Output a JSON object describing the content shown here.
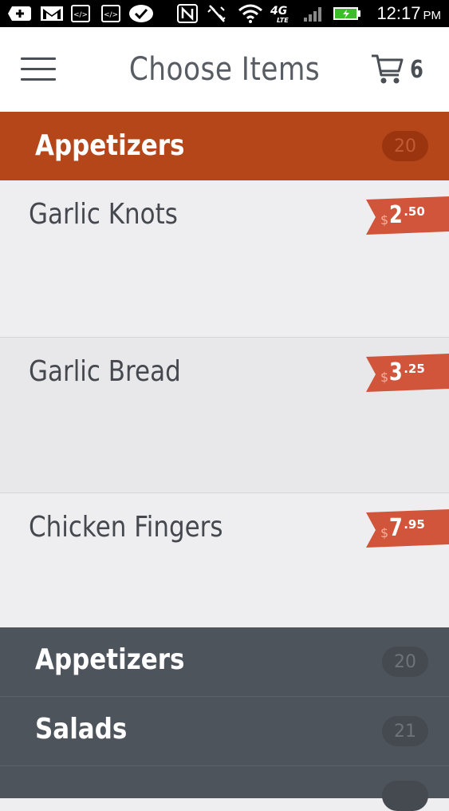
{
  "status_bar": {
    "time": "12:17",
    "ampm": "PM",
    "network": "4G LTE",
    "icons": [
      "add-icon",
      "gmail-icon",
      "code-icon",
      "code-icon",
      "check-bubble-icon",
      "nfc-icon",
      "vibrate-icon",
      "wifi-icon",
      "lte-icon",
      "signal-icon",
      "battery-icon"
    ]
  },
  "header": {
    "title": "Choose Items",
    "cart_count": "6"
  },
  "active_category": {
    "name": "Appetizers",
    "count": "20"
  },
  "items": [
    {
      "name": "Garlic Knots",
      "price_dollar": "$",
      "price_whole": "2",
      "price_cents": ".50"
    },
    {
      "name": "Garlic Bread",
      "price_dollar": "$",
      "price_whole": "3",
      "price_cents": ".25"
    },
    {
      "name": "Chicken Fingers",
      "price_dollar": "$",
      "price_whole": "7",
      "price_cents": ".95"
    }
  ],
  "categories": [
    {
      "name": "Appetizers",
      "count": "20"
    },
    {
      "name": "Salads",
      "count": "21"
    }
  ],
  "colors": {
    "accent": "#b5461a",
    "price_tag": "#d0553a",
    "category_list_bg": "#4e545c"
  }
}
